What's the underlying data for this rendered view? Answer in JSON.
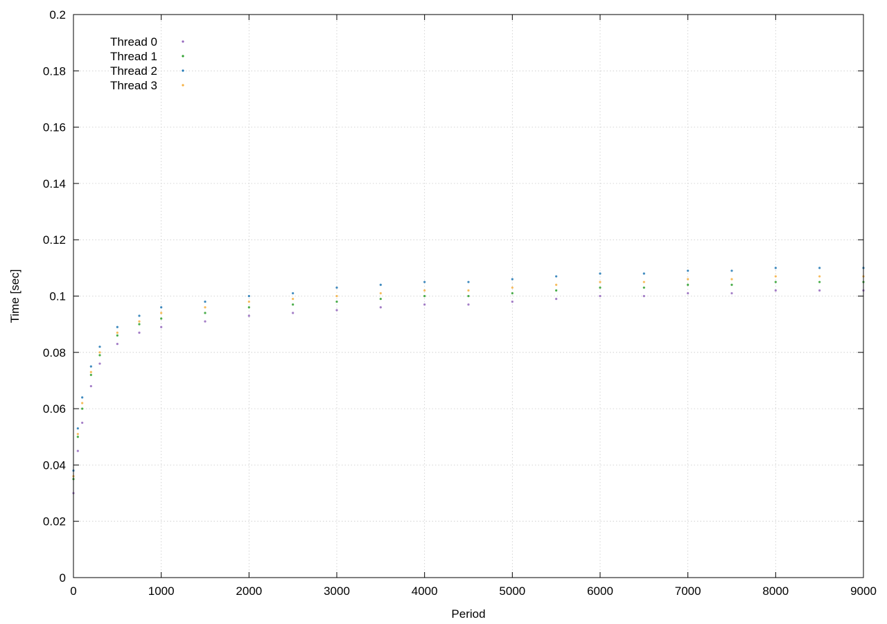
{
  "chart_data": {
    "type": "scatter",
    "title": "",
    "xlabel": "Period",
    "ylabel": "Time [sec]",
    "xlim": [
      0,
      9000
    ],
    "ylim": [
      0,
      0.2
    ],
    "xticks": [
      0,
      1000,
      2000,
      3000,
      4000,
      5000,
      6000,
      7000,
      8000,
      9000
    ],
    "xtick_labels": [
      "0",
      "1000",
      "2000",
      "3000",
      "4000",
      "5000",
      "6000",
      "7000",
      "8000",
      "9000"
    ],
    "yticks": [
      0,
      0.02,
      0.04,
      0.06,
      0.08,
      0.1,
      0.12,
      0.14,
      0.16,
      0.18,
      0.2
    ],
    "ytick_labels": [
      "0",
      "0.02",
      "0.04",
      "0.06",
      "0.08",
      "0.1",
      "0.12",
      "0.14",
      "0.16",
      "0.18",
      "0.2"
    ],
    "grid": true,
    "legend_position": "top-left",
    "marker": "dot",
    "series": [
      {
        "name": "Thread 0",
        "color": "#9467bd",
        "x": [
          0,
          50,
          100,
          200,
          300,
          500,
          750,
          1000,
          1500,
          2000,
          2500,
          3000,
          3500,
          4000,
          4500,
          5000,
          5500,
          6000,
          6500,
          7000,
          7500,
          8000,
          8500,
          9000
        ],
        "y": [
          0.03,
          0.045,
          0.055,
          0.068,
          0.076,
          0.083,
          0.087,
          0.089,
          0.091,
          0.093,
          0.094,
          0.095,
          0.096,
          0.097,
          0.097,
          0.098,
          0.099,
          0.1,
          0.1,
          0.101,
          0.101,
          0.102,
          0.102,
          0.102
        ]
      },
      {
        "name": "Thread 1",
        "color": "#2ca02c",
        "x": [
          0,
          50,
          100,
          200,
          300,
          500,
          750,
          1000,
          1500,
          2000,
          2500,
          3000,
          3500,
          4000,
          4500,
          5000,
          5500,
          6000,
          6500,
          7000,
          7500,
          8000,
          8500,
          9000
        ],
        "y": [
          0.035,
          0.05,
          0.06,
          0.072,
          0.079,
          0.086,
          0.09,
          0.092,
          0.094,
          0.096,
          0.097,
          0.098,
          0.099,
          0.1,
          0.1,
          0.101,
          0.102,
          0.103,
          0.103,
          0.104,
          0.104,
          0.105,
          0.105,
          0.105
        ]
      },
      {
        "name": "Thread 2",
        "color": "#1f77b4",
        "x": [
          0,
          50,
          100,
          200,
          300,
          500,
          750,
          1000,
          1500,
          2000,
          2500,
          3000,
          3500,
          4000,
          4500,
          5000,
          5500,
          6000,
          6500,
          7000,
          7500,
          8000,
          8500,
          9000
        ],
        "y": [
          0.038,
          0.053,
          0.064,
          0.075,
          0.082,
          0.089,
          0.093,
          0.096,
          0.098,
          0.1,
          0.101,
          0.103,
          0.104,
          0.105,
          0.105,
          0.106,
          0.107,
          0.108,
          0.108,
          0.109,
          0.109,
          0.11,
          0.11,
          0.11
        ]
      },
      {
        "name": "Thread 3",
        "color": "#f5b041",
        "x": [
          0,
          50,
          100,
          200,
          300,
          500,
          750,
          1000,
          1500,
          2000,
          2500,
          3000,
          3500,
          4000,
          4500,
          5000,
          5500,
          6000,
          6500,
          7000,
          7500,
          8000,
          8500,
          9000
        ],
        "y": [
          0.036,
          0.051,
          0.062,
          0.073,
          0.08,
          0.087,
          0.091,
          0.094,
          0.096,
          0.098,
          0.099,
          0.1,
          0.101,
          0.102,
          0.102,
          0.103,
          0.104,
          0.105,
          0.105,
          0.106,
          0.106,
          0.107,
          0.107,
          0.107
        ]
      }
    ]
  }
}
